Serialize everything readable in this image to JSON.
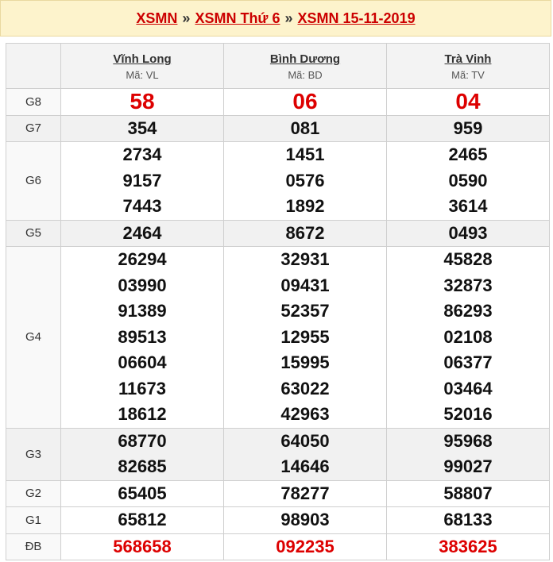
{
  "breadcrumb": {
    "crumb1": "XSMN",
    "crumb2": "XSMN Thứ 6",
    "crumb3": "XSMN 15-11-2019",
    "separator": "»"
  },
  "provinces": [
    {
      "name": "Vĩnh Long",
      "code": "Mã: VL"
    },
    {
      "name": "Bình Dương",
      "code": "Mã: BD"
    },
    {
      "name": "Trà Vinh",
      "code": "Mã: TV"
    }
  ],
  "prizes": [
    {
      "label": "G8",
      "values": [
        [
          "58"
        ],
        [
          "06"
        ],
        [
          "04"
        ]
      ]
    },
    {
      "label": "G7",
      "values": [
        [
          "354"
        ],
        [
          "081"
        ],
        [
          "959"
        ]
      ]
    },
    {
      "label": "G6",
      "values": [
        [
          "2734",
          "9157",
          "7443"
        ],
        [
          "1451",
          "0576",
          "1892"
        ],
        [
          "2465",
          "0590",
          "3614"
        ]
      ]
    },
    {
      "label": "G5",
      "values": [
        [
          "2464"
        ],
        [
          "8672"
        ],
        [
          "0493"
        ]
      ]
    },
    {
      "label": "G4",
      "values": [
        [
          "26294",
          "03990",
          "91389",
          "89513",
          "06604",
          "11673",
          "18612"
        ],
        [
          "32931",
          "09431",
          "52357",
          "12955",
          "15995",
          "63022",
          "42963"
        ],
        [
          "45828",
          "32873",
          "86293",
          "02108",
          "06377",
          "03464",
          "52016"
        ]
      ]
    },
    {
      "label": "G3",
      "values": [
        [
          "68770",
          "82685"
        ],
        [
          "64050",
          "14646"
        ],
        [
          "95968",
          "99027"
        ]
      ]
    },
    {
      "label": "G2",
      "values": [
        [
          "65405"
        ],
        [
          "78277"
        ],
        [
          "58807"
        ]
      ]
    },
    {
      "label": "G1",
      "values": [
        [
          "65812"
        ],
        [
          "98903"
        ],
        [
          "68133"
        ]
      ]
    },
    {
      "label": "ĐB",
      "values": [
        [
          "568658"
        ],
        [
          "092235"
        ],
        [
          "383625"
        ]
      ]
    }
  ],
  "colors": {
    "link": "#cc0000",
    "highlight": "#dd0000",
    "header_bg": "#fdf3cc"
  }
}
